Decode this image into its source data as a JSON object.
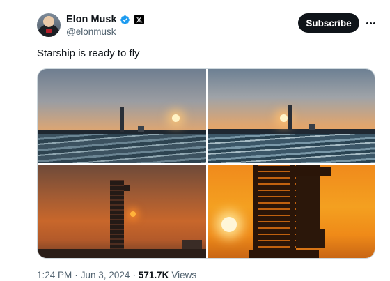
{
  "author": {
    "display_name": "Elon Musk",
    "handle": "@elonmusk",
    "verified": true,
    "affiliation_badge": "x-logo-icon"
  },
  "actions": {
    "subscribe_label": "Subscribe",
    "more_icon": "more-horizontal-icon"
  },
  "post": {
    "text": "Starship is ready to fly",
    "media_count": 4
  },
  "meta": {
    "time": "1:24 PM",
    "separator": "·",
    "date": "Jun 3, 2024",
    "views_count": "571.7K",
    "views_label": "Views"
  },
  "colors": {
    "accent": "#1d9bf0",
    "button_bg": "#0f1419",
    "secondary_text": "#536471"
  }
}
